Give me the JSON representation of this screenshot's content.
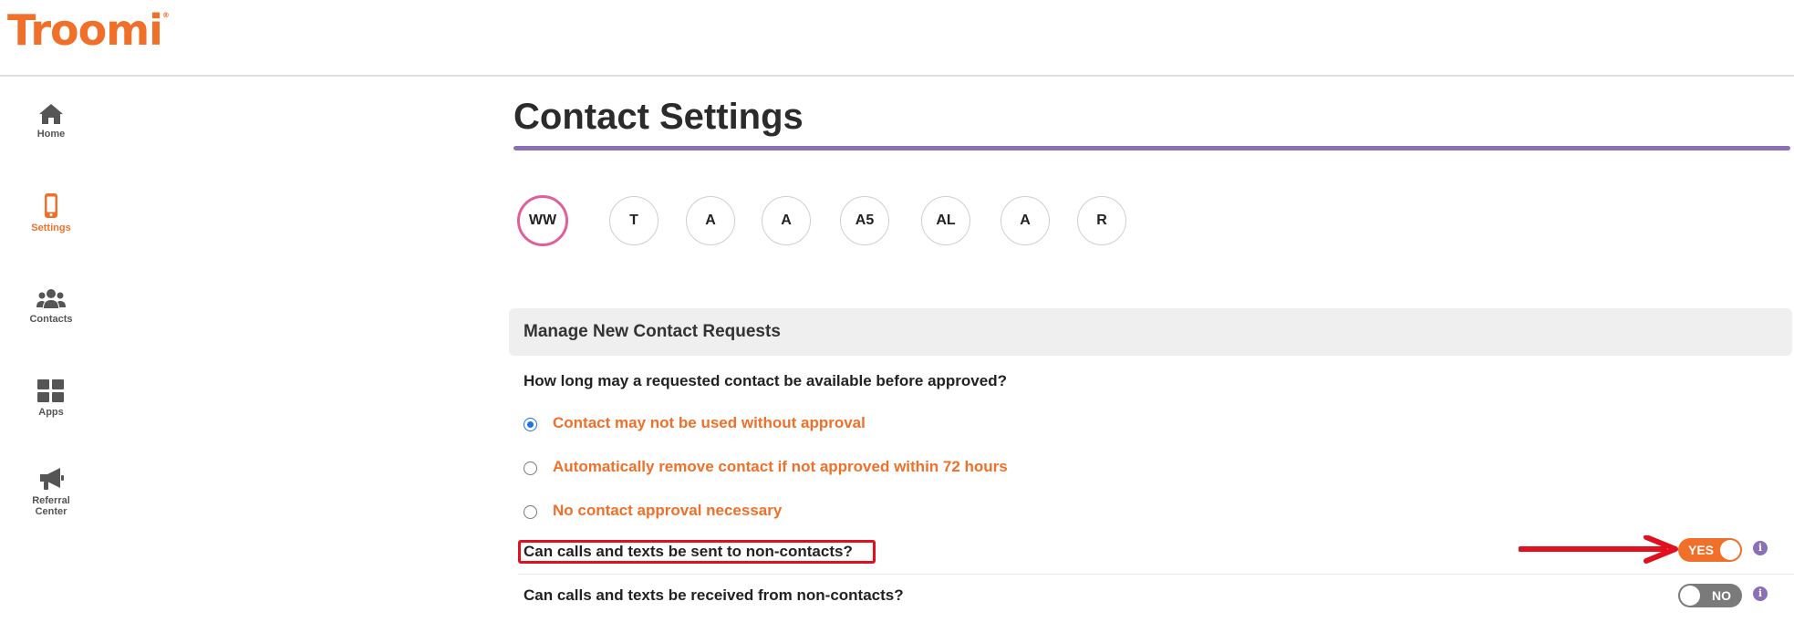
{
  "brand": {
    "name": "Troomi",
    "mark": "®",
    "color": "#f07029"
  },
  "sidebar": {
    "items": [
      {
        "label": "Home",
        "icon": "home-icon",
        "active": false
      },
      {
        "label": "Settings",
        "icon": "phone-icon",
        "active": true
      },
      {
        "label": "Contacts",
        "icon": "people-icon",
        "active": false
      },
      {
        "label": "Apps",
        "icon": "grid-icon",
        "active": false
      },
      {
        "label": "Referral",
        "label2": "Center",
        "icon": "megaphone-icon",
        "active": false
      }
    ]
  },
  "page": {
    "title": "Contact Settings",
    "accent": "#8b70b8"
  },
  "profiles": [
    {
      "initials": "WW",
      "active": true
    },
    {
      "initials": "T",
      "active": false
    },
    {
      "initials": "A",
      "active": false
    },
    {
      "initials": "A",
      "active": false
    },
    {
      "initials": "A5",
      "active": false
    },
    {
      "initials": "AL",
      "active": false
    },
    {
      "initials": "A",
      "active": false
    },
    {
      "initials": "R",
      "active": false
    }
  ],
  "section": {
    "title": "Manage New Contact Requests",
    "question": "How long may a requested contact be available before approved?",
    "options": [
      {
        "label": "Contact may not be used without approval",
        "checked": true
      },
      {
        "label": "Automatically remove contact if not approved within 72 hours",
        "checked": false
      },
      {
        "label": "No contact approval necessary",
        "checked": false
      }
    ]
  },
  "toggles": [
    {
      "question": "Can calls and texts be sent to non-contacts?",
      "value": "YES",
      "on": true,
      "highlighted": true
    },
    {
      "question": "Can calls and texts be received from non-contacts?",
      "value": "NO",
      "on": false,
      "highlighted": false
    }
  ],
  "info_symbol": "i",
  "annotation": {
    "color": "#e0101e"
  }
}
